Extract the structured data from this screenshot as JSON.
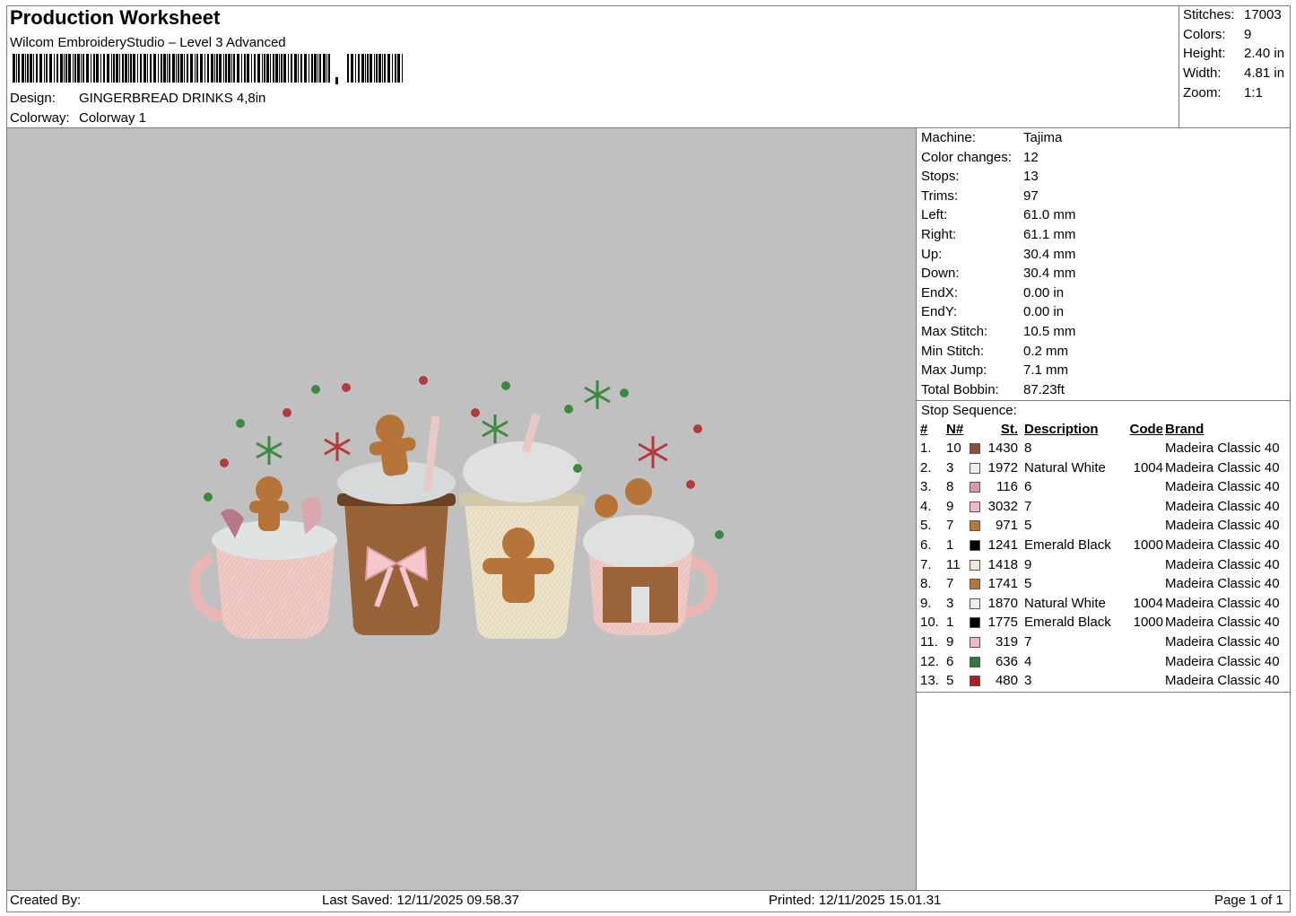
{
  "header": {
    "title": "Production Worksheet",
    "software": "Wilcom EmbroideryStudio – Level 3 Advanced",
    "design_label": "Design:",
    "design_value": "GINGERBREAD DRINKS 4,8in",
    "colorway_label": "Colorway:",
    "colorway_value": "Colorway 1"
  },
  "summary": [
    {
      "label": "Stitches:",
      "value": "17003"
    },
    {
      "label": "Colors:",
      "value": "9"
    },
    {
      "label": "Height:",
      "value": "2.40 in"
    },
    {
      "label": "Width:",
      "value": "4.81 in"
    },
    {
      "label": "Zoom:",
      "value": "1:1"
    }
  ],
  "machine_stats": [
    {
      "label": "Machine:",
      "value": "Tajima"
    },
    {
      "label": "Color changes:",
      "value": "12"
    },
    {
      "label": "Stops:",
      "value": "13"
    },
    {
      "label": "Trims:",
      "value": "97"
    },
    {
      "label": "Left:",
      "value": "61.0 mm"
    },
    {
      "label": "Right:",
      "value": "61.1 mm"
    },
    {
      "label": "Up:",
      "value": "30.4 mm"
    },
    {
      "label": "Down:",
      "value": "30.4 mm"
    },
    {
      "label": "EndX:",
      "value": "0.00 in"
    },
    {
      "label": "EndY:",
      "value": "0.00 in"
    },
    {
      "label": "Max Stitch:",
      "value": "10.5 mm"
    },
    {
      "label": "Min Stitch:",
      "value": "0.2 mm"
    },
    {
      "label": "Max Jump:",
      "value": "7.1 mm"
    },
    {
      "label": "Total Bobbin:",
      "value": "87.23ft"
    }
  ],
  "stop_sequence": {
    "title": "Stop Sequence:",
    "columns": {
      "idx": "#",
      "needle": "N#",
      "stitches": "St.",
      "description": "Description",
      "code": "Code",
      "brand": "Brand"
    },
    "rows": [
      {
        "idx": "1.",
        "needle": "10",
        "color": "#8a5033",
        "stitches": "1430",
        "description": "8",
        "code": "",
        "brand": "Madeira Classic 40"
      },
      {
        "idx": "2.",
        "needle": "3",
        "color": "#eeeeee",
        "stitches": "1972",
        "description": "Natural White",
        "code": "1004",
        "brand": "Madeira Classic 40"
      },
      {
        "idx": "3.",
        "needle": "8",
        "color": "#d79aa6",
        "stitches": "116",
        "description": "6",
        "code": "",
        "brand": "Madeira Classic 40"
      },
      {
        "idx": "4.",
        "needle": "9",
        "color": "#f0b8c4",
        "stitches": "3032",
        "description": "7",
        "code": "",
        "brand": "Madeira Classic 40"
      },
      {
        "idx": "5.",
        "needle": "7",
        "color": "#b5773e",
        "stitches": "971",
        "description": "5",
        "code": "",
        "brand": "Madeira Classic 40"
      },
      {
        "idx": "6.",
        "needle": "1",
        "color": "#000000",
        "stitches": "1241",
        "description": "Emerald Black",
        "code": "1000",
        "brand": "Madeira Classic 40"
      },
      {
        "idx": "7.",
        "needle": "11",
        "color": "#f1e6d2",
        "stitches": "1418",
        "description": "9",
        "code": "",
        "brand": "Madeira Classic 40"
      },
      {
        "idx": "8.",
        "needle": "7",
        "color": "#b5773e",
        "stitches": "1741",
        "description": "5",
        "code": "",
        "brand": "Madeira Classic 40"
      },
      {
        "idx": "9.",
        "needle": "3",
        "color": "#eeeeee",
        "stitches": "1870",
        "description": "Natural White",
        "code": "1004",
        "brand": "Madeira Classic 40"
      },
      {
        "idx": "10.",
        "needle": "1",
        "color": "#000000",
        "stitches": "1775",
        "description": "Emerald Black",
        "code": "1000",
        "brand": "Madeira Classic 40"
      },
      {
        "idx": "11.",
        "needle": "9",
        "color": "#f0b8c4",
        "stitches": "319",
        "description": "7",
        "code": "",
        "brand": "Madeira Classic 40"
      },
      {
        "idx": "12.",
        "needle": "6",
        "color": "#2f7a35",
        "stitches": "636",
        "description": "4",
        "code": "",
        "brand": "Madeira Classic 40"
      },
      {
        "idx": "13.",
        "needle": "5",
        "color": "#a82224",
        "stitches": "480",
        "description": "3",
        "code": "",
        "brand": "Madeira Classic 40"
      }
    ]
  },
  "footer": {
    "created_by": "Created By:",
    "last_saved": "Last Saved: 12/11/2025 09.58.37",
    "printed": "Printed: 12/11/2025 15.01.31",
    "page": "Page 1 of 1"
  }
}
